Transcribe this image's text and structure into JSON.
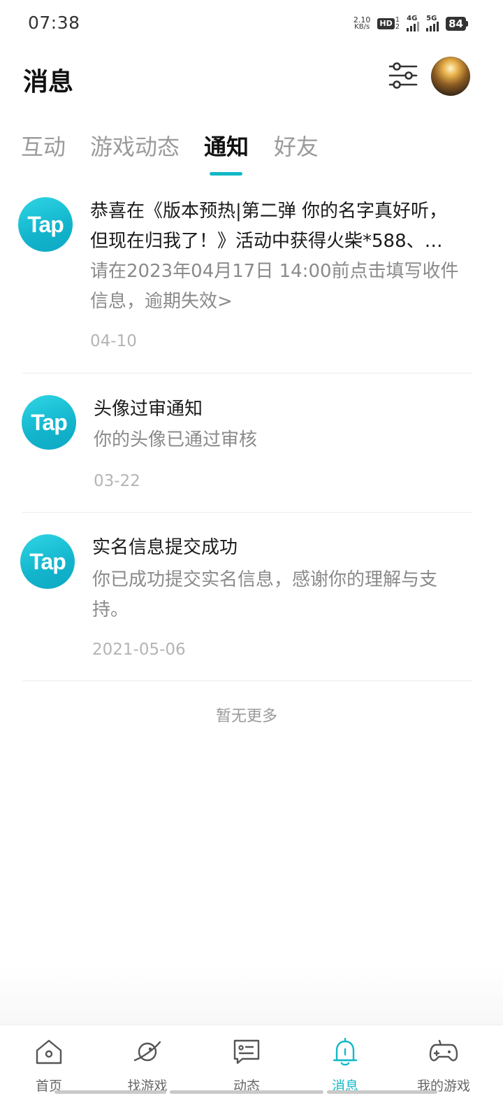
{
  "status_bar": {
    "time": "07:38",
    "net_speed_value": "2.10",
    "net_speed_unit": "KB/s",
    "hd_label": "HD",
    "hd_sub_top": "1",
    "hd_sub_bottom": "2",
    "signal_1_label": "4G",
    "signal_2_label": "5G",
    "battery": "84"
  },
  "header": {
    "title": "消息"
  },
  "tabs": [
    {
      "label": "互动",
      "active": false
    },
    {
      "label": "游戏动态",
      "active": false
    },
    {
      "label": "通知",
      "active": true
    },
    {
      "label": "好友",
      "active": false
    }
  ],
  "notifications": [
    {
      "logo_text": "Tap",
      "title_line1": "恭喜在《版本预热|第二弹 你的名字真好听，",
      "title_line2": "但现在归我了！》活动中获得火柴*588、…",
      "desc_line1": "请在2023年04月17日 14:00前点击填写收件",
      "desc_line2": "信息，逾期失效>",
      "date": "04-10"
    },
    {
      "logo_text": "Tap",
      "title": "头像过审通知",
      "desc": "你的头像已通过审核",
      "date": "03-22"
    },
    {
      "logo_text": "Tap",
      "title": "实名信息提交成功",
      "desc_line1": "你已成功提交实名信息，感谢你的理解与支",
      "desc_line2": "持。",
      "date": "2021-05-06"
    }
  ],
  "no_more_text": "暂无更多",
  "bottom_nav": [
    {
      "label": "首页",
      "icon": "home-icon",
      "active": false
    },
    {
      "label": "找游戏",
      "icon": "planet-icon",
      "active": false
    },
    {
      "label": "动态",
      "icon": "chat-icon",
      "active": false
    },
    {
      "label": "消息",
      "icon": "bell-icon",
      "active": true
    },
    {
      "label": "我的游戏",
      "icon": "gamepad-icon",
      "active": false
    }
  ],
  "colors": {
    "accent": "#14b9c8",
    "inactive_text": "#9b9b9b"
  }
}
